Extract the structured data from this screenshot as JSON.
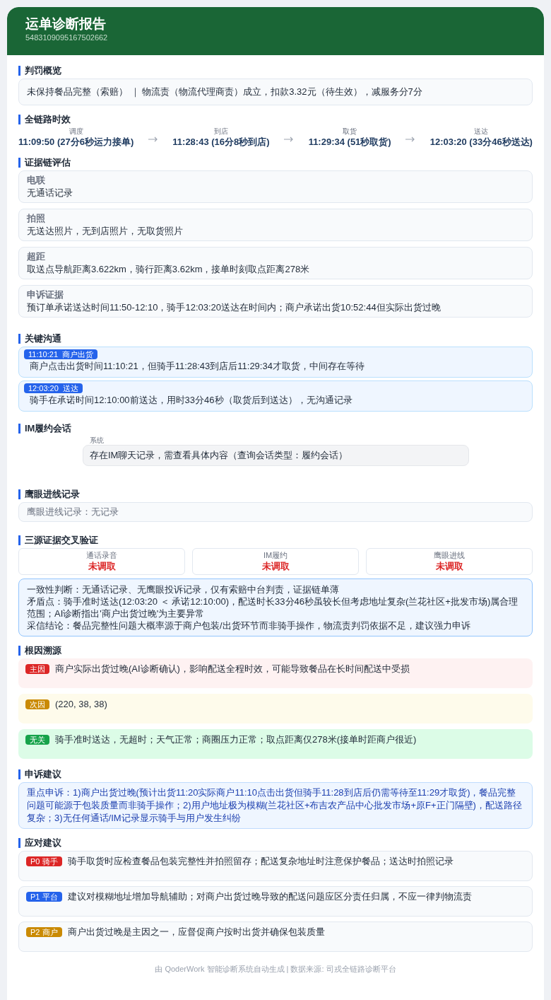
{
  "header": {
    "title": "运单诊断报告",
    "order_id": "5483109095167502662"
  },
  "penalty": {
    "title": "判罚概览",
    "text": "未保持餐品完整（索赔） ｜ 物流责（物流代理商责）成立，扣款3.32元（待生效），减服务分7分"
  },
  "timeline": {
    "title": "全链路时效",
    "steps": [
      {
        "label": "调度",
        "value": "11:09:50 (27分6秒运力接单)"
      },
      {
        "label": "到店",
        "value": "11:28:43 (16分8秒到店)"
      },
      {
        "label": "取货",
        "value": "11:29:34 (51秒取货)"
      },
      {
        "label": "送达",
        "value": "12:03:20 (33分46秒送达)"
      }
    ]
  },
  "evidence": {
    "title": "证据链评估",
    "items": [
      {
        "label": "电联",
        "text": "无通话记录"
      },
      {
        "label": "拍照",
        "text": "无送达照片，无到店照片，无取货照片"
      },
      {
        "label": "超距",
        "text": "取送点导航距离3.622km，骑行距离3.62km，接单时刻取点距离278米"
      },
      {
        "label": "申诉证据",
        "text": "预订单承诺送达时间11:50-12:10，骑手12:03:20送达在时间内；商户承诺出货10:52:44但实际出货过晚"
      }
    ]
  },
  "communication": {
    "title": "关键沟通",
    "items": [
      {
        "tag": "11:10:21  商户出货",
        "text": "商户点击出货时间11:10:21，但骑手11:28:43到店后11:29:34才取货，中间存在等待"
      },
      {
        "tag": "12:03:20  送达",
        "text": "骑手在承诺时间12:10:00前送达，用时33分46秒（取货后到送达），无沟通记录"
      }
    ]
  },
  "im": {
    "title": "IM履约会话",
    "messages": [
      {
        "sender": "系统",
        "text": "存在IM聊天记录，需查看具体内容（查询会话类型：履约会话）"
      }
    ]
  },
  "eagle_eye": {
    "title": "鹰眼进线记录",
    "text": "鹰眼进线记录：无记录"
  },
  "cross_check": {
    "title": "三源证据交叉验证",
    "sources": [
      {
        "label": "通话录音",
        "value": "未调取"
      },
      {
        "label": "IM履约",
        "value": "未调取"
      },
      {
        "label": "鹰眼进线",
        "value": "未调取"
      }
    ],
    "conclusions": [
      "一致性判断：无通话记录、无鹰眼投诉记录，仅有索赔中台判责，证据链单薄",
      "矛盾点：骑手准时送达(12:03:20 ＜ 承诺12:10:00)，配送时长33分46秒虽较长但考虑地址复杂(兰花社区+批发市场)属合理范围；AI诊断指出'商户出货过晚'为主要异常",
      "采信结论：餐品完整性问题大概率源于商户包装/出货环节而非骑手操作，物流责判罚依据不足，建议强力申诉"
    ]
  },
  "root_cause": {
    "title": "根因溯源",
    "items": [
      {
        "kind": "main",
        "tag": "主因",
        "text": "商户实际出货过晚(AI诊断确认)，影响配送全程时效，可能导致餐品在长时间配送中受损"
      },
      {
        "kind": "secondary",
        "tag": "次因",
        "text": "(220, 38, 38)"
      },
      {
        "kind": "unrelated",
        "tag": "无关",
        "text": "骑手准时送达，无超时；天气正常；商圈压力正常；取点距离仅278米(接单时距商户很近)"
      }
    ]
  },
  "appeal": {
    "title": "申诉建议",
    "text": "重点申诉：1)商户出货过晚(预计出货11:20实际商户11:10点击出货但骑手11:28到店后仍需等待至11:29才取货)，餐品完整问题可能源于包装质量而非骑手操作；2)用户地址极为模糊(兰花社区+布吉农产品中心批发市场+原F+正门隔壁)，配送路径复杂；3)无任何通话/IM记录显示骑手与用户发生纠纷"
  },
  "actions": {
    "title": "应对建议",
    "items": [
      {
        "kind": "p0",
        "tag": "P0 骑手",
        "text": "骑手取货时应检查餐品包装完整性并拍照留存；配送复杂地址时注意保护餐品；送达时拍照记录"
      },
      {
        "kind": "p1",
        "tag": "P1 平台",
        "text": "建议对模糊地址增加导航辅助；对商户出货过晚导致的配送问题应区分责任归属，不应一律判物流责"
      },
      {
        "kind": "p2",
        "tag": "P2 商户",
        "text": "商户出货过晚是主因之一，应督促商户按时出货并确保包装质量"
      }
    ]
  },
  "footer": "由 QoderWork 智能诊断系统自动生成 | 数据来源: 司戎全链路诊断平台"
}
